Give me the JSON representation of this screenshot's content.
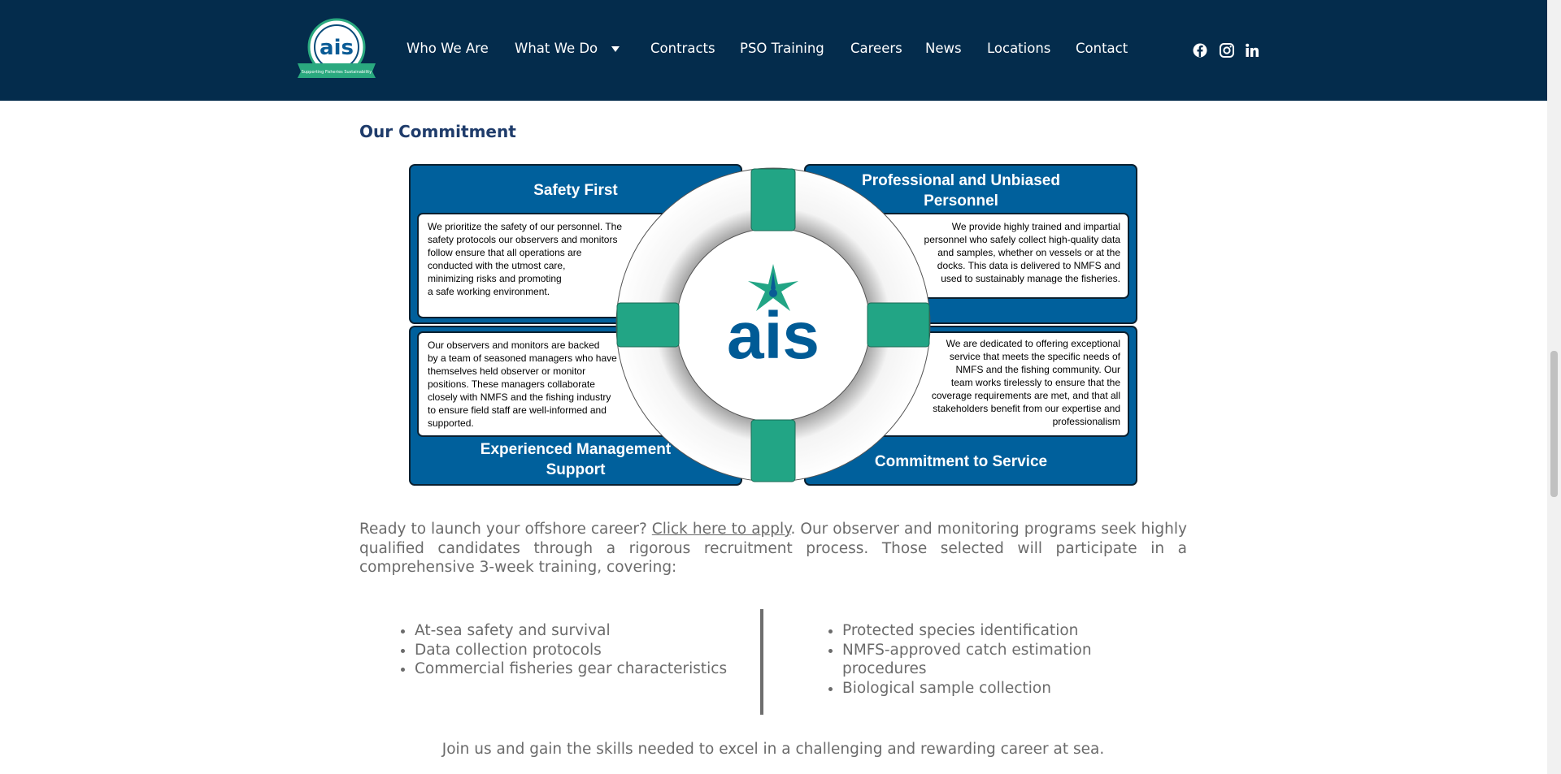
{
  "logo": {
    "text": "ais",
    "ribbon": "Supporting Fisheries Sustainability"
  },
  "nav": {
    "items": [
      "Who We Are",
      "What We Do",
      "Contracts",
      "PSO Training",
      "Careers",
      "News",
      "Locations",
      "Contact"
    ]
  },
  "social": [
    "facebook-icon",
    "instagram-icon",
    "linkedin-icon"
  ],
  "main": {
    "section_title": "Our Commitment",
    "infographic": {
      "center_logo": "ais",
      "safety": {
        "title": "Safety First",
        "lines": [
          "We prioritize the safety of our personnel.  The",
          "safety protocols our observers and monitors",
          "follow ensure that all operations are",
          "conducted with the utmost care,",
          "minimizing risks and promoting",
          "a safe working environment."
        ]
      },
      "professional": {
        "title_line1": "Professional and Unbiased",
        "title_line2": "Personnel",
        "lines": [
          "We provide highly trained and impartial",
          "personnel who safely collect high-quality data",
          "and samples, whether on vessels or at the",
          "docks. This data is delivered to NMFS and",
          "used to sustainably manage the fisheries."
        ]
      },
      "management": {
        "title_line1": "Experienced Management",
        "title_line2": "Support",
        "lines": [
          "Our observers and monitors are backed",
          "by a team of seasoned managers who have",
          "themselves held observer or monitor",
          "positions. These managers collaborate",
          "closely with NMFS and the fishing industry",
          "to ensure field staff are well-informed and",
          "supported."
        ]
      },
      "service": {
        "title": "Commitment to Service",
        "lines": [
          "We are dedicated to offering exceptional",
          "service that meets the specific needs of",
          "NMFS and the fishing community. Our",
          "team works tirelessly to ensure that the",
          "coverage requirements are met, and that all",
          "stakeholders benefit from our expertise and",
          "professionalism"
        ]
      }
    },
    "intro_before_link": "Ready to launch your offshore career? ",
    "intro_link": "Click here to apply",
    "intro_after_link": ". Our observer and monitoring programs seek highly qualified candidates through a rigorous recruitment process. Those selected will participate in a comprehensive 3-week training, covering:",
    "list_left": [
      "At-sea safety and survival",
      "Data collection protocols",
      "Commercial fisheries gear characteristics"
    ],
    "list_right": [
      "Protected species identification",
      "NMFS-approved catch estimation procedures",
      "Biological sample collection"
    ],
    "closing": "Join us and gain the skills needed to excel in a challenging and rewarding career at sea."
  },
  "colors": {
    "header_bg": "#042c4c",
    "panel_blue": "#00609c",
    "teal": "#22a585",
    "logo_blue": "#005b96"
  }
}
